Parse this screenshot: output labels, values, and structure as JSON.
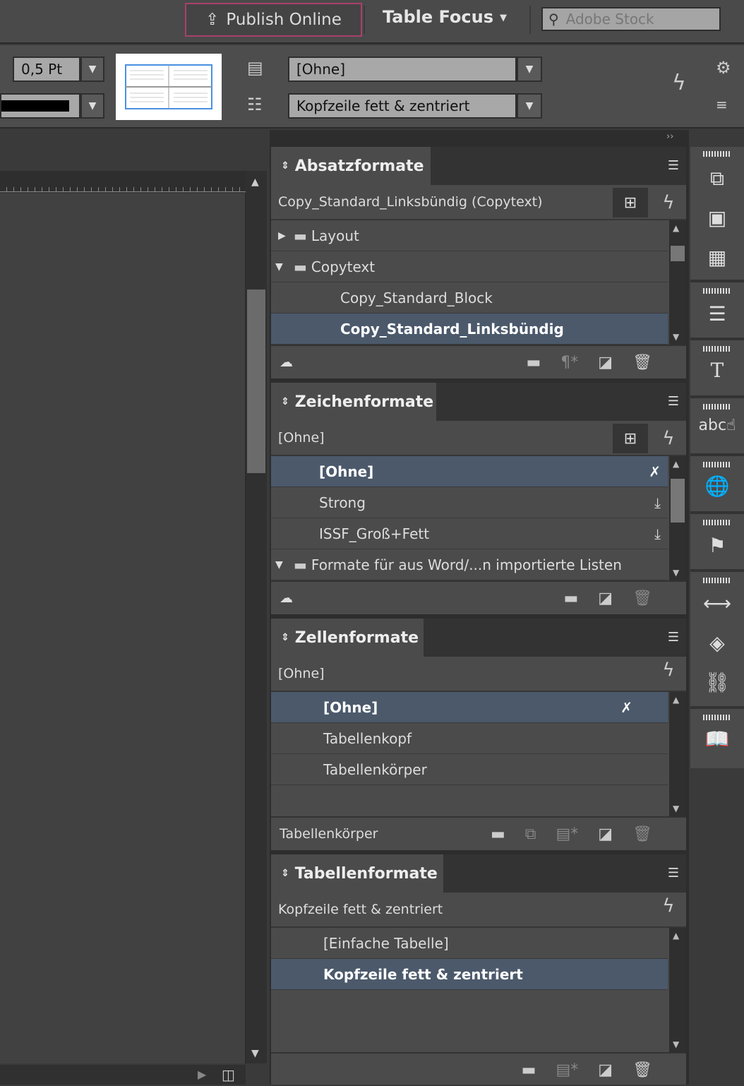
{
  "topbar": {
    "publish_label": "Publish Online",
    "workspace": "Table Focus",
    "search_placeholder": "Adobe Stock"
  },
  "control": {
    "stroke_weight": "0,5 Pt",
    "cell_style": "[Ohne]",
    "table_style": "Kopfzeile fett & zentriert"
  },
  "panels": {
    "absatz": {
      "title": "Absatzformate",
      "current": "Copy_Standard_Linksbündig (Copytext)",
      "items": [
        {
          "label": "Layout",
          "type": "folder",
          "expanded": false
        },
        {
          "label": "Copytext",
          "type": "folder",
          "expanded": true
        },
        {
          "label": "Copy_Standard_Block"
        },
        {
          "label": "Copy_Standard_Linksbündig",
          "selected": true
        }
      ]
    },
    "zeichen": {
      "title": "Zeichenformate",
      "current": "[Ohne]",
      "items": [
        {
          "label": "[Ohne]",
          "selected": true
        },
        {
          "label": "Strong"
        },
        {
          "label": "ISSF_Groß+Fett"
        },
        {
          "label": "Formate für aus Word/...n importierte Listen",
          "type": "folder",
          "expanded": true
        }
      ]
    },
    "zellen": {
      "title": "Zellenformate",
      "current": "[Ohne]",
      "items": [
        {
          "label": "[Ohne]",
          "selected": true
        },
        {
          "label": "Tabellenkopf"
        },
        {
          "label": "Tabellenkörper"
        }
      ],
      "footer_label": "Tabellenkörper"
    },
    "tabellen": {
      "title": "Tabellenformate",
      "current": "Kopfzeile fett & zentriert",
      "items": [
        {
          "label": "[Einfache Tabelle]"
        },
        {
          "label": "Kopfzeile fett & zentriert",
          "selected": true
        }
      ]
    }
  },
  "colors": {
    "selection": "#4b596b",
    "publish_border": "#a8416b",
    "panel": "#4b4b4b"
  }
}
